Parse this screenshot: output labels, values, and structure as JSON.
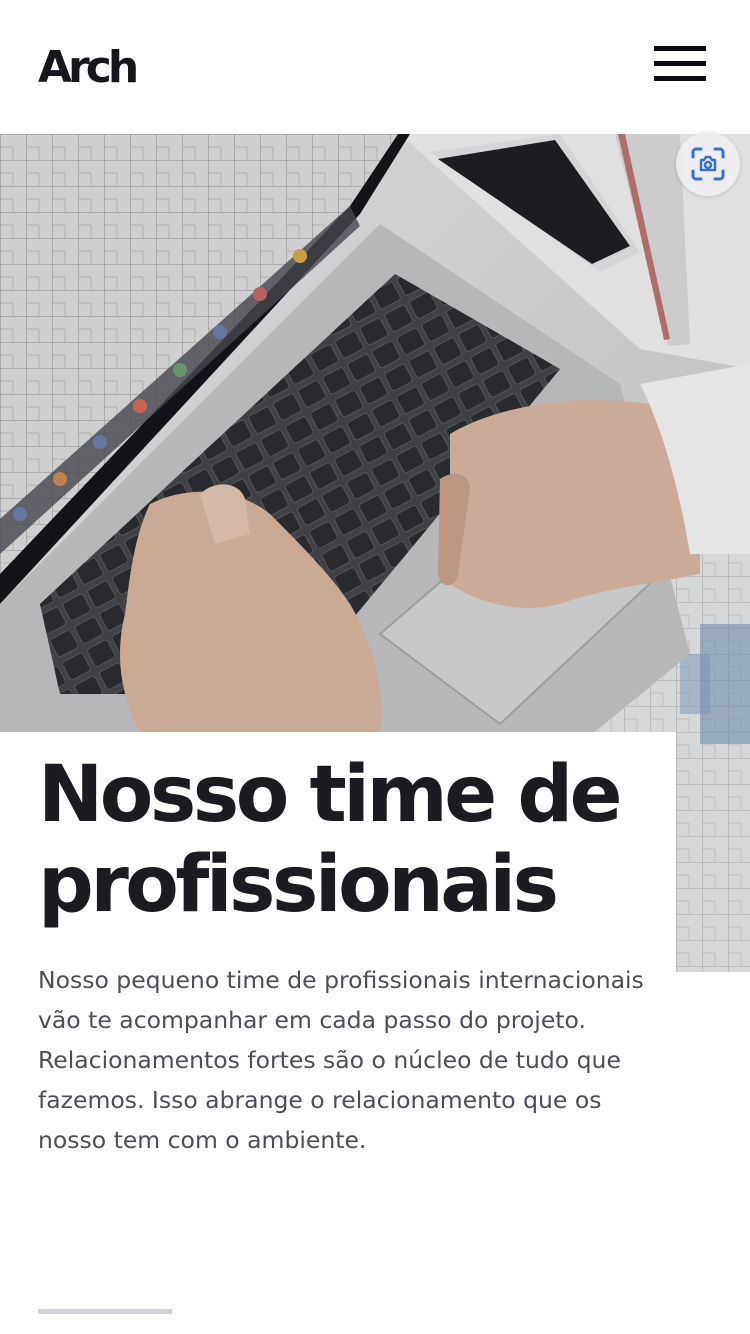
{
  "header": {
    "logo_text": "Arch",
    "menu_icon": "hamburger-menu-icon"
  },
  "hero": {
    "image_description_icon": "laptop-architecture-photo",
    "lens_icon": "visual-search-icon"
  },
  "content": {
    "title": "Nosso time de profissionais",
    "description": "Nosso pequeno time de profissionais internacionais vão te acompanhar em cada passo do projeto. Relacionamentos fortes são o núcleo de tudo que fazemos. Isso abrange o relacionamento que os nosso tem com o ambiente."
  },
  "colors": {
    "title": "#1b1b21",
    "body_text": "#4e4e58",
    "divider": "#d2d2dd",
    "lens_accent": "#3a6fd8"
  }
}
